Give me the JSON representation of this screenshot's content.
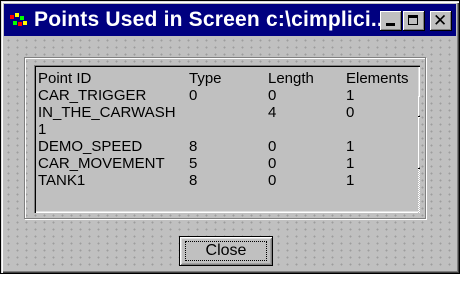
{
  "window": {
    "title": "Points Used in Screen c:\\cimplici...",
    "buttons": {
      "minimize": "minimize",
      "maximize": "maximize",
      "close": "close"
    }
  },
  "list": {
    "rows": [
      [
        "Point ID",
        "Type",
        "Length",
        "Elements"
      ],
      [
        "CAR_TRIGGER",
        "0",
        "0",
        "1"
      ],
      [
        "IN_THE_CARWASH",
        "",
        "4",
        "0"
      ],
      [
        "1",
        "",
        "",
        ""
      ],
      [
        "DEMO_SPEED",
        "8",
        "0",
        "1"
      ],
      [
        "CAR_MOVEMENT",
        "5",
        "0",
        "1"
      ],
      [
        "TANK1",
        "8",
        "0",
        "1"
      ]
    ]
  },
  "actions": {
    "close_label": "Close"
  },
  "colors": {
    "titlebar": "#000080",
    "face": "#c0c0c0"
  }
}
